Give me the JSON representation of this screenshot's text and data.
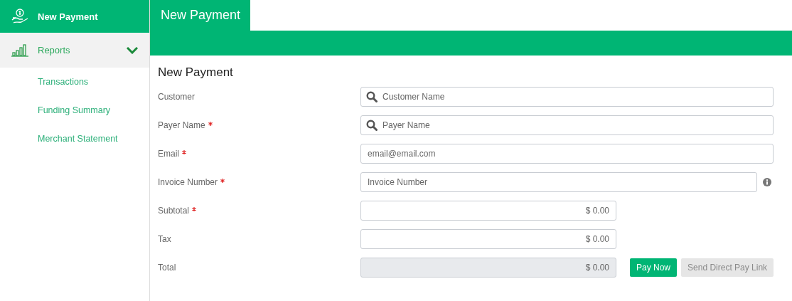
{
  "sidebar": {
    "items": [
      {
        "label": "New Payment",
        "selected": true
      },
      {
        "label": "Reports",
        "selected": false,
        "expanded": true,
        "children": [
          {
            "label": "Transactions"
          },
          {
            "label": "Funding Summary"
          },
          {
            "label": "Merchant Statement"
          }
        ]
      }
    ]
  },
  "tabs": [
    {
      "label": "New Payment",
      "selected": true
    }
  ],
  "form": {
    "title": "New Payment",
    "fields": [
      {
        "label": "Customer",
        "kind": "search",
        "required": false,
        "placeholder": "Customer Name"
      },
      {
        "label": "Payer Name",
        "kind": "search",
        "required": true,
        "placeholder": "Payer Name"
      },
      {
        "label": "Email",
        "kind": "text",
        "required": true,
        "placeholder": "email@email.com"
      },
      {
        "label": "Invoice Number",
        "kind": "text",
        "required": true,
        "placeholder": "Invoice Number",
        "info": true
      },
      {
        "label": "Subtotal",
        "kind": "amount",
        "required": true,
        "value": "$ 0.00"
      },
      {
        "label": "Tax",
        "kind": "amount",
        "required": false,
        "value": "$ 0.00"
      },
      {
        "label": "Total",
        "kind": "amount",
        "required": false,
        "value": "$ 0.00",
        "disabled": true
      }
    ],
    "buttons": [
      {
        "label": "Pay Now",
        "disabled": false
      },
      {
        "label": "Send Direct Pay Link",
        "disabled": true
      }
    ]
  }
}
